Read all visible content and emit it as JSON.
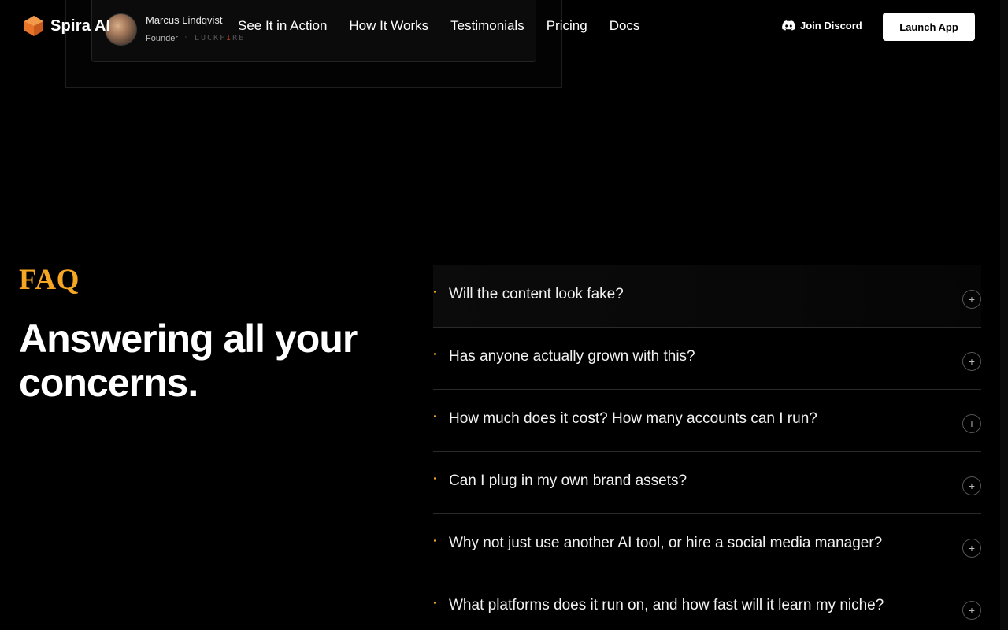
{
  "nav": {
    "brand": "Spira AI",
    "links": [
      "See It in Action",
      "How It Works",
      "Testimonials",
      "Pricing",
      "Docs"
    ],
    "discord_label": "Join Discord",
    "launch_label": "Launch App"
  },
  "testimonial": {
    "name": "Marcus Lindqvist",
    "role": "Founder",
    "separator": "·",
    "company_a": "LUCKF",
    "company_b": "I",
    "company_c": "RE"
  },
  "faq": {
    "label": "FAQ",
    "title": "Answering all your concerns.",
    "items": [
      "Will the content look fake?",
      "Has anyone actually grown with this?",
      "How much does it cost? How many accounts can I run?",
      "Can I plug in my own brand assets?",
      "Why not just use another AI tool, or hire a social media manager?",
      "What platforms does it run on, and how fast will it learn my niche?"
    ],
    "expand_glyph": "+"
  },
  "colors": {
    "accent": "#f5a623",
    "background": "#000000",
    "logo": "#e8742a"
  }
}
